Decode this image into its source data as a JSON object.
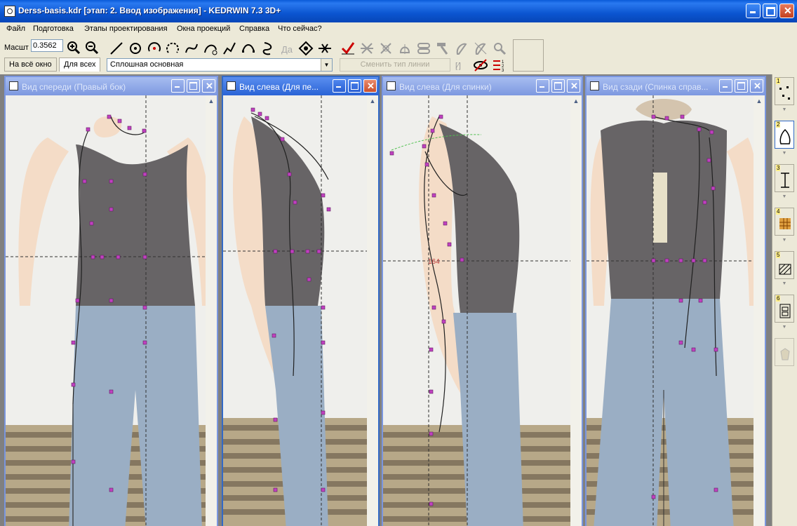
{
  "window": {
    "title": "Derss-basis.kdr [этап: 2. Ввод изображения] - KEDRWIN 7.3 3D+"
  },
  "menu": [
    "Файл",
    "Подготовка",
    "Этапы проектирования",
    "Окна проекций",
    "Справка",
    "Что сейчас?"
  ],
  "toolbar": {
    "scale_label": "Масшт",
    "scale_value": "0.3562",
    "fit_window_label": "На всё окно",
    "fit_all_label": "Для всех",
    "line_type_value": "Сплошная основная",
    "change_line_type_label": "Сменить тип линии"
  },
  "views": [
    {
      "title": "Вид спереди (Правый бок)"
    },
    {
      "title": "Вид слева (Для пе..."
    },
    {
      "title": "Вид слева (Для спинки)"
    },
    {
      "title": "Вид сзади (Спинка справ..."
    }
  ],
  "measure_text": "164",
  "stages": [
    "1",
    "2",
    "3",
    "4",
    "5",
    "6"
  ],
  "colors": {
    "accent": "#3169c6",
    "points": "#c040c0",
    "curve": "#202020"
  }
}
